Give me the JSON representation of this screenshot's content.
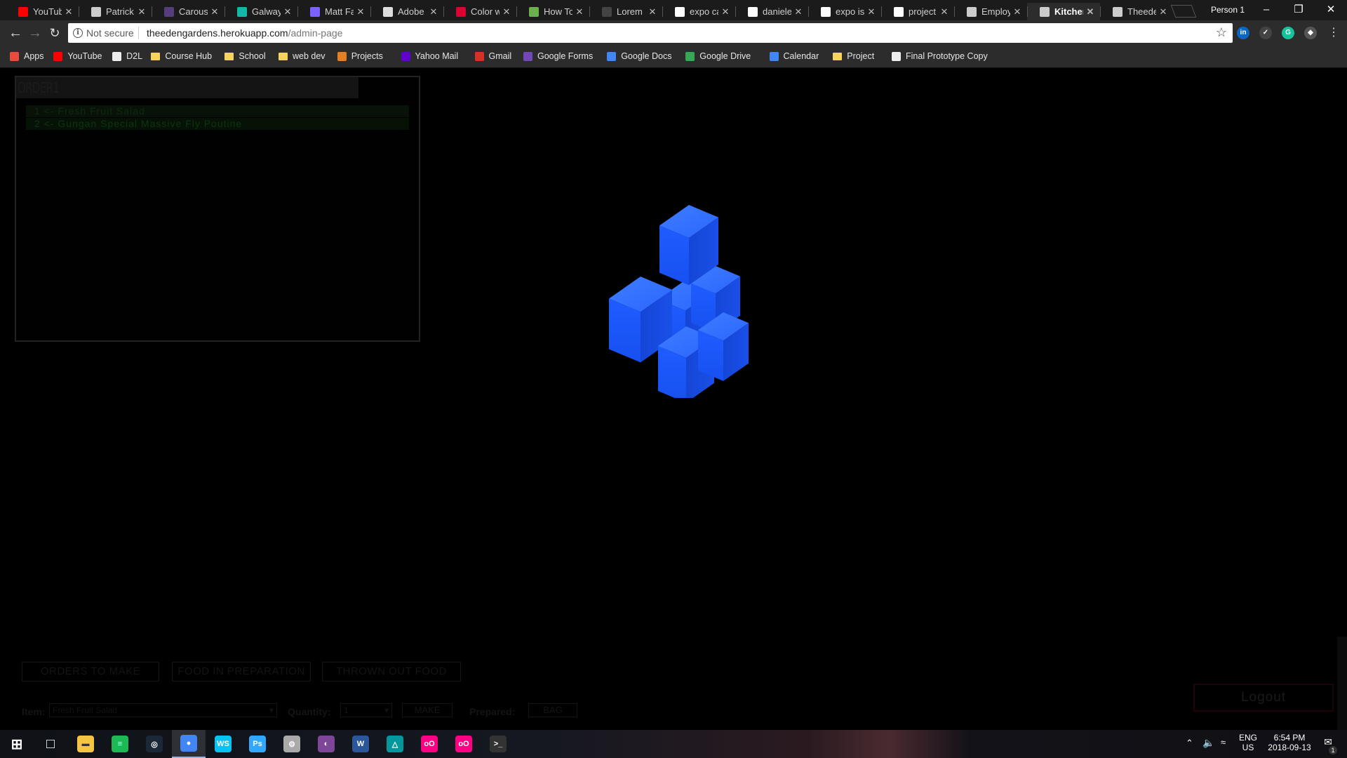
{
  "browser": {
    "tabs": [
      {
        "title": "YouTube",
        "icon": "youtube-icon",
        "color": "#ff0000"
      },
      {
        "title": "Patrick F",
        "icon": "page-icon",
        "color": "#cccccc"
      },
      {
        "title": "Carousel",
        "icon": "bootstrap-icon",
        "color": "#563d7c"
      },
      {
        "title": "Galway t",
        "icon": "galway-icon",
        "color": "#14b8a6"
      },
      {
        "title": "Matt Far",
        "icon": "chart-icon",
        "color": "#7b61ff"
      },
      {
        "title": "Adobe Il",
        "icon": "adobe-icon",
        "color": "#dddddd"
      },
      {
        "title": "Color wh",
        "icon": "angular-icon",
        "color": "#dd0031"
      },
      {
        "title": "How To",
        "icon": "howto-icon",
        "color": "#6ab04c"
      },
      {
        "title": "Lorem Ip",
        "icon": "blank-icon",
        "color": "#444444"
      },
      {
        "title": "expo can",
        "icon": "google-icon",
        "color": "#ffffff"
      },
      {
        "title": "danielel",
        "icon": "github-icon",
        "color": "#ffffff"
      },
      {
        "title": "expo is",
        "icon": "google-icon",
        "color": "#ffffff"
      },
      {
        "title": "project",
        "icon": "google-icon",
        "color": "#ffffff"
      },
      {
        "title": "Employ",
        "icon": "page-icon",
        "color": "#cccccc"
      },
      {
        "title": "Kitchen",
        "icon": "page-icon",
        "color": "#cccccc",
        "active": true
      },
      {
        "title": "Theeden",
        "icon": "page-icon",
        "color": "#cccccc"
      }
    ],
    "profile": "Person 1",
    "security_label": "Not secure",
    "url_host": "theedengardens.herokuapp.com",
    "url_path": "/admin-page",
    "bookmarks": [
      {
        "label": "Apps",
        "icon": "apps-grid-icon"
      },
      {
        "label": "YouTube",
        "icon": "youtube-icon"
      },
      {
        "label": "D2L",
        "icon": "d2l-icon"
      },
      {
        "label": "Course Hub",
        "icon": "folder-icon"
      },
      {
        "label": "School",
        "icon": "folder-icon"
      },
      {
        "label": "web dev",
        "icon": "folder-icon"
      },
      {
        "label": "Projects",
        "icon": "projects-icon"
      },
      {
        "label": "Yahoo Mail",
        "icon": "yahoo-icon"
      },
      {
        "label": "Gmail",
        "icon": "gmail-icon"
      },
      {
        "label": "Google Forms",
        "icon": "forms-icon"
      },
      {
        "label": "Google Docs",
        "icon": "docs-icon"
      },
      {
        "label": "Google Drive",
        "icon": "drive-icon"
      },
      {
        "label": "Calendar",
        "icon": "calendar-icon"
      },
      {
        "label": "Project",
        "icon": "folder-icon"
      },
      {
        "label": "Final Prototype Copy",
        "icon": "sheet-icon"
      }
    ],
    "extensions": [
      {
        "name": "linkedin-extension-icon",
        "text": "in",
        "color": "#0a66c2"
      },
      {
        "name": "reader-extension-icon",
        "text": "✓",
        "color": "#444444"
      },
      {
        "name": "grammarly-extension-icon",
        "text": "G",
        "color": "#15c39a"
      },
      {
        "name": "dev-extension-icon",
        "text": "◆",
        "color": "#555555"
      }
    ]
  },
  "page": {
    "order_title": "ORDER1",
    "order_items": [
      "1 <- Fresh Fruit Salad",
      "2 <- Gungan Special Massive Fly Poutine"
    ],
    "tabs": [
      "ORDERS TO MAKE",
      "FOOD IN PREPARATION",
      "THROWN OUT FOOD"
    ],
    "item_label": "Item:",
    "item_value": "Fresh Fruit Salad",
    "quantity_label": "Quantity:",
    "quantity_value": "1",
    "make_label": "MAKE",
    "prepared_label": "Prepared:",
    "bag_label": "BAG",
    "logout_label": "Logout",
    "loader_color": "#1a5cff"
  },
  "taskbar": {
    "apps": [
      "start-icon",
      "task-view-icon",
      "file-explorer-icon",
      "spotify-icon",
      "steam-icon",
      "chrome-icon",
      "webstorm-icon",
      "photoshop-icon",
      "settings-icon",
      "tor-icon",
      "word-icon",
      "arduino-icon",
      "flickr-icon",
      "flickr-alt-icon",
      "terminal-icon"
    ],
    "lang_top": "ENG",
    "lang_bottom": "US",
    "time": "6:54 PM",
    "date": "2018-09-13",
    "notification_count": "1"
  }
}
